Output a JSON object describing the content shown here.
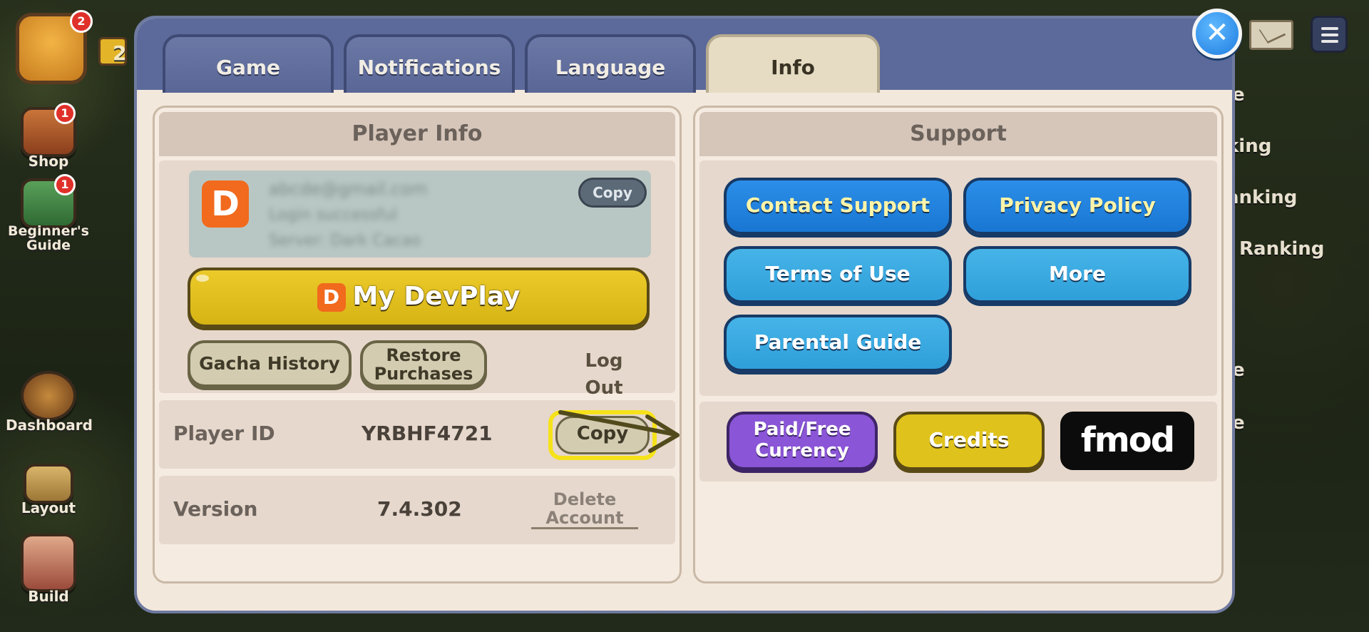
{
  "hud": {
    "avatar_badge": "2",
    "crown_count": "2",
    "left_items": [
      {
        "label": "Shop",
        "badge": "1"
      },
      {
        "label": "Beginner's\nGuide",
        "badge": "1"
      },
      {
        "label": "Dashboard"
      },
      {
        "label": "Layout"
      },
      {
        "label": "Build"
      }
    ],
    "right_fragments": [
      "e",
      "king",
      "anking",
      "Ranking",
      "e",
      "e"
    ]
  },
  "tabs": [
    {
      "label": "Game",
      "active": false
    },
    {
      "label": "Notifications",
      "active": false
    },
    {
      "label": "Language",
      "active": false
    },
    {
      "label": "Info",
      "active": true
    }
  ],
  "player_info": {
    "title": "Player Info",
    "account": {
      "logo": "D",
      "email": "abcde@gmail.com",
      "status": "Login successful",
      "server": "Server: Dark Cacao",
      "copy_label": "Copy"
    },
    "devplay_button": {
      "logo": "D",
      "label": "My DevPlay"
    },
    "gacha_history_label": "Gacha History",
    "restore_purchases_label": "Restore Purchases",
    "logout_label": "Log Out",
    "player_id_label": "Player ID",
    "player_id_value": "YRBHF4721",
    "player_id_copy_label": "Copy",
    "version_label": "Version",
    "version_value": "7.4.302",
    "delete_account_label": "Delete Account"
  },
  "support": {
    "title": "Support",
    "contact_support": "Contact Support",
    "privacy_policy": "Privacy Policy",
    "terms_of_use": "Terms of Use",
    "more": "More",
    "parental_guide": "Parental Guide",
    "paid_free_currency": "Paid/Free Currency",
    "credits": "Credits",
    "fmod": "fmod"
  },
  "colors": {
    "accent_highlight": "#f6e21a",
    "tab_bar": "#5b6a9a",
    "panel_bg": "#f3e8dc"
  }
}
